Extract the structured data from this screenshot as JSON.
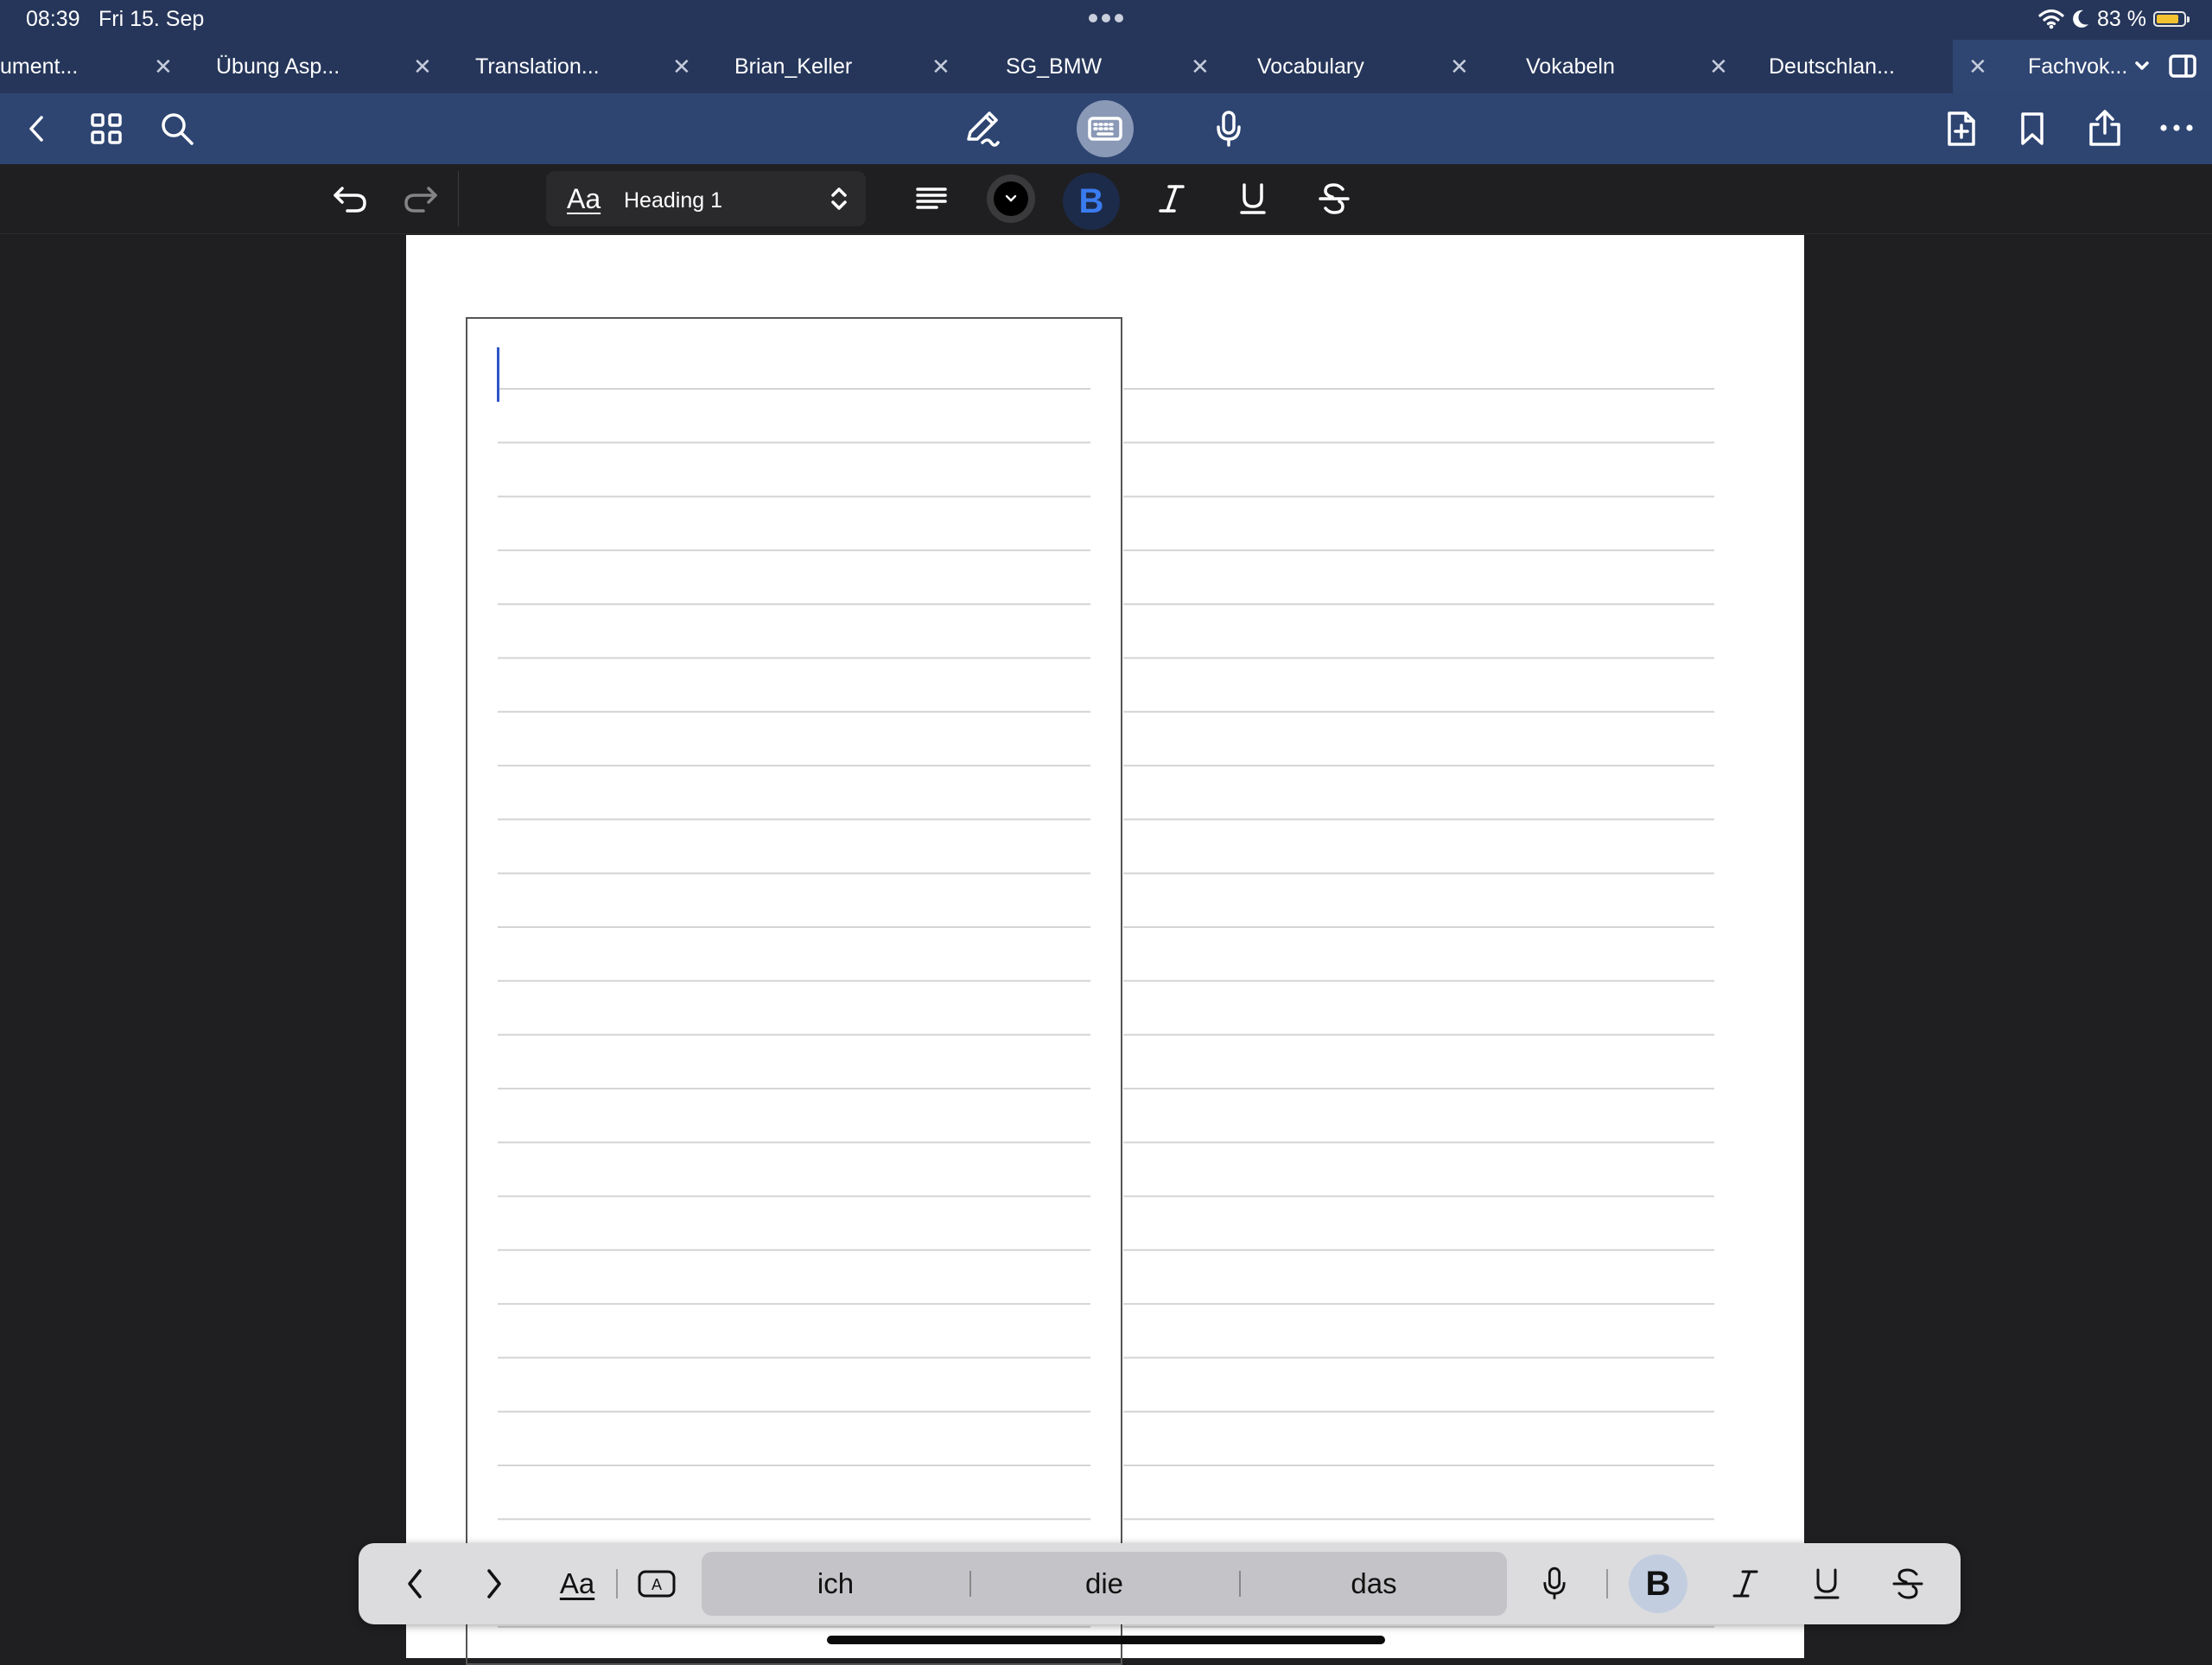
{
  "status_bar": {
    "time": "08:39",
    "date": "Fri 15. Sep",
    "battery_text": "83 %",
    "battery_level_percent": 83,
    "icons": [
      "wifi-icon",
      "moon-icon",
      "battery-icon"
    ]
  },
  "tabs": [
    {
      "title": "ument..."
    },
    {
      "title": "Übung Asp..."
    },
    {
      "title": "Translation..."
    },
    {
      "title": "Brian_Keller"
    },
    {
      "title": "SG_BMW"
    },
    {
      "title": "Vocabulary"
    },
    {
      "title": "Vokabeln"
    },
    {
      "title": "Deutschlan..."
    },
    {
      "title": "Fachvok...",
      "active": true
    }
  ],
  "toolbar": {
    "left_icons": [
      "back-chevron-icon",
      "grid-icon",
      "search-icon"
    ],
    "center_icons": [
      "pen-icon",
      "keyboard-icon",
      "microphone-icon"
    ],
    "right_icons": [
      "add-page-icon",
      "bookmark-icon",
      "share-icon",
      "more-icon"
    ]
  },
  "format_bar": {
    "style_prefix": "Aa",
    "paragraph_style": "Heading 1",
    "text_color": "#000000",
    "bold_active": true,
    "accent_color": "#2f6fe0"
  },
  "shortcut_bar": {
    "format_label": "Aa",
    "suggestions": [
      "ich",
      "die",
      "das"
    ],
    "bold_active": true
  },
  "colors": {
    "tab_bar": "#26365a",
    "toolbar": "#2e4572",
    "canvas": "#1f1f21",
    "page": "#ffffff"
  }
}
